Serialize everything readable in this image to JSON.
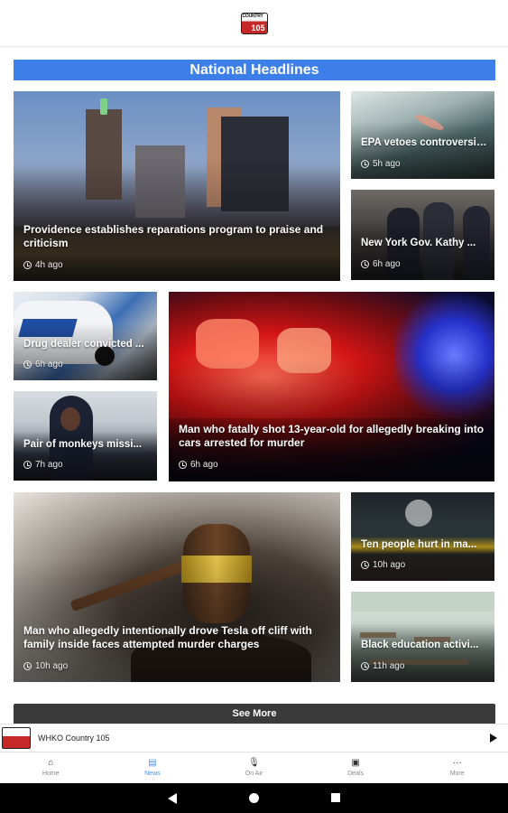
{
  "section": {
    "title": "National Headlines"
  },
  "articles": [
    {
      "title": "Providence establishes reparations program to praise and criticism",
      "time": "4h ago"
    },
    {
      "title": "EPA vetoes controversial...",
      "time": "5h ago"
    },
    {
      "title": "New York Gov. Kathy ...",
      "time": "6h ago"
    },
    {
      "title": "Drug dealer convicted ...",
      "time": "6h ago"
    },
    {
      "title": "Man who fatally shot 13-year-old for allegedly breaking into cars arrested for murder",
      "time": "6h ago"
    },
    {
      "title": "Pair of monkeys missi...",
      "time": "7h ago"
    },
    {
      "title": "Man who allegedly intentionally drove Tesla off cliff with family inside faces attempted murder charges",
      "time": "10h ago"
    },
    {
      "title": "Ten people hurt in ma...",
      "time": "10h ago"
    },
    {
      "title": "Black education activi...",
      "time": "11h ago"
    }
  ],
  "see_more": "See More",
  "player": {
    "station": "WHKO Country 105"
  },
  "tabs": [
    {
      "label": "Home",
      "icon": "home-icon"
    },
    {
      "label": "News",
      "icon": "news-icon"
    },
    {
      "label": "On Air",
      "icon": "microphone-icon"
    },
    {
      "label": "Deals",
      "icon": "bag-icon"
    },
    {
      "label": "More",
      "icon": "more-icon"
    }
  ],
  "colors": {
    "accent": "#3d7fe8",
    "active_tab": "#4a90e2",
    "see_more_bg": "#3a3a3a"
  }
}
